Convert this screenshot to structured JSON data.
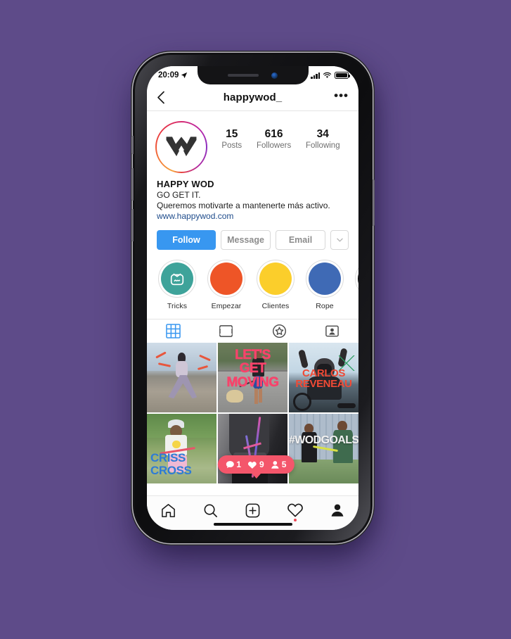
{
  "theme": {
    "background": "#5E4B89",
    "accent_blue": "#3897F0",
    "link_blue": "#204D8C",
    "badge_pink": "#F4566B",
    "notification_dot": "#ED4956"
  },
  "status_bar": {
    "time": "20:09",
    "location_icon": "location-arrow-icon",
    "signal_icon": "cellular-signal-icon",
    "wifi_icon": "wifi-icon",
    "battery_icon": "battery-full-icon"
  },
  "header": {
    "back_icon": "chevron-left-icon",
    "title": "happywod_",
    "more_icon": "ellipsis-icon"
  },
  "profile": {
    "avatar_name": "happy-wod-logo",
    "stats": [
      {
        "value": "15",
        "label": "Posts"
      },
      {
        "value": "616",
        "label": "Followers"
      },
      {
        "value": "34",
        "label": "Following"
      }
    ],
    "display_name": "HAPPY WOD",
    "tagline": "GO GET IT.",
    "description": "Queremos motivarte a mantenerte más activo.",
    "website": "www.happywod.com"
  },
  "actions": {
    "follow": "Follow",
    "message": "Message",
    "email": "Email",
    "dropdown_icon": "chevron-down-icon"
  },
  "highlights": [
    {
      "label": "Tricks",
      "color": "#3EA39A",
      "icon": "igtv-icon"
    },
    {
      "label": "Empezar",
      "color": "#EE5527",
      "icon": ""
    },
    {
      "label": "Clientes",
      "color": "#FBCE2B",
      "icon": ""
    },
    {
      "label": "Rope",
      "color": "#3F6AB5",
      "icon": ""
    },
    {
      "label": "",
      "color": "#0B0B0B",
      "icon": ""
    }
  ],
  "content_tabs": [
    {
      "name": "grid",
      "icon": "grid-icon",
      "active": true
    },
    {
      "name": "feed",
      "icon": "feed-view-icon",
      "active": false
    },
    {
      "name": "guides",
      "icon": "star-guides-icon",
      "active": false
    },
    {
      "name": "tagged",
      "icon": "tagged-user-icon",
      "active": false
    }
  ],
  "posts": [
    {
      "id": "post-1",
      "caption": "",
      "alt": "woman stretching on rocky beach"
    },
    {
      "id": "post-2",
      "caption": "LET'S GET MOVING",
      "alt": "man running with dog on road"
    },
    {
      "id": "post-3",
      "caption": "CARLOS REVENEAU",
      "alt": "cyclist raising arms in celebration"
    },
    {
      "id": "post-4",
      "caption": "CRISS CROSS",
      "alt": "person with jump rope in park"
    },
    {
      "id": "post-5",
      "caption": "",
      "alt": "close up of athletic wear and jump rope"
    },
    {
      "id": "post-6",
      "caption": "#WODGOALS",
      "alt": "two people exercising outdoors in city"
    }
  ],
  "notification_badge": {
    "comments": "1",
    "likes": "9",
    "followers": "5",
    "comment_icon": "comment-bubble-icon",
    "like_icon": "heart-icon",
    "follower_icon": "person-icon"
  },
  "bottom_nav": [
    {
      "name": "home",
      "icon": "home-icon"
    },
    {
      "name": "search",
      "icon": "search-icon"
    },
    {
      "name": "create",
      "icon": "plus-square-icon"
    },
    {
      "name": "activity",
      "icon": "heart-icon",
      "dot": true
    },
    {
      "name": "profile",
      "icon": "person-filled-icon"
    }
  ]
}
